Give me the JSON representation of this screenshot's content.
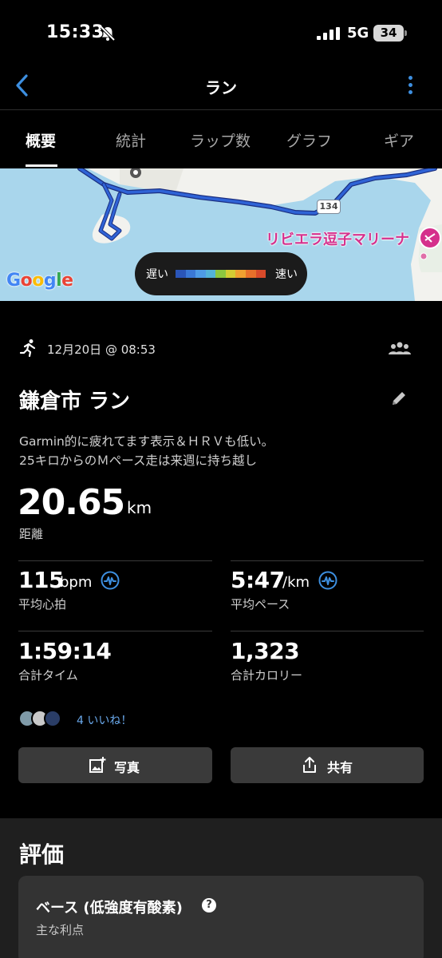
{
  "status_bar": {
    "time": "15:33",
    "network": "5G",
    "battery": "34"
  },
  "nav": {
    "title": "ラン"
  },
  "tabs": [
    {
      "label": "概要",
      "active": true
    },
    {
      "label": "統計",
      "active": false
    },
    {
      "label": "ラップ数",
      "active": false
    },
    {
      "label": "グラフ",
      "active": false
    },
    {
      "label": "ギア",
      "active": false
    }
  ],
  "map": {
    "poi_label": "リビエラ逗子マリーナ",
    "route_number": "134",
    "place_label": "江の島",
    "provider": "Google",
    "legend": {
      "slow_label": "遅い",
      "fast_label": "速い",
      "colors": [
        "#2a55b8",
        "#3a78d6",
        "#4e9be6",
        "#53b3d8",
        "#8cc63f",
        "#d4cc33",
        "#f0a030",
        "#e8702a",
        "#d84a2a"
      ]
    },
    "colors": {
      "water": "#a9d6ec",
      "land": "#f2f2ee",
      "route": "#2f63d6"
    }
  },
  "activity": {
    "date": "12月20日 @ 08:53",
    "title": "鎌倉市 ラン",
    "notes": [
      "Garmin的に疲れてます表示＆ＨＲＶも低い。",
      "25キロからのＭペース走は来週に持ち越し"
    ],
    "distance": {
      "value": "20.65",
      "unit": "km",
      "label": "距離"
    },
    "stats": {
      "heart_rate": {
        "value": "115",
        "unit": "bpm",
        "label": "平均心拍"
      },
      "pace": {
        "value": "5:47",
        "unit": "/km",
        "label": "平均ペース"
      },
      "time": {
        "value": "1:59:14",
        "label": "合計タイム"
      },
      "calories": {
        "value": "1,323",
        "label": "合計カロリー"
      }
    },
    "likes": "4 いいね！",
    "buttons": {
      "photo": "写真",
      "share": "共有"
    }
  },
  "evaluation": {
    "heading": "評価",
    "card_title": "ベース (低強度有酸素)",
    "card_subtitle": "主な利点"
  },
  "theme": {
    "background": "#000000",
    "accent": "#3d8fe0",
    "like_color": "#6aa9ec",
    "button_bg": "#3a3a3a",
    "poi_color": "#d5308c"
  }
}
